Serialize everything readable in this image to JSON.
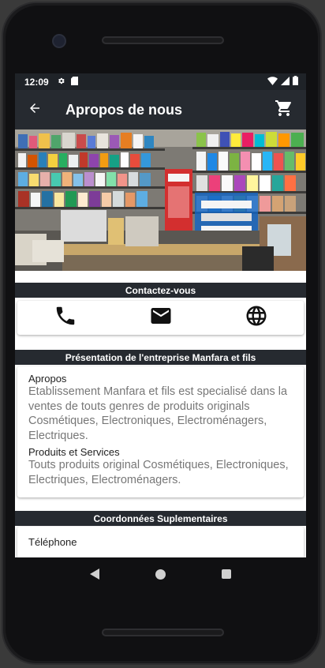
{
  "status_bar": {
    "time": "12:09",
    "left_icons": [
      "gear-icon",
      "sd-card-icon"
    ],
    "right_icons": [
      "wifi-icon",
      "signal-icon",
      "battery-icon"
    ]
  },
  "app_bar": {
    "title": "Apropos de nous",
    "back_icon": "arrow-back-icon",
    "cart_icon": "shopping-cart-icon"
  },
  "sections": {
    "contact_header": "Contactez-vous",
    "presentation_header": "Présentation de l'entreprise Manfara et fils",
    "extra_header": "Coordonnées Suplementaires"
  },
  "contact_actions": [
    "phone-icon",
    "email-icon",
    "globe-icon"
  ],
  "presentation": {
    "about_label": "Apropos",
    "about_text": "Etablissement Manfara et fils est specialisé dans la ventes de touts genres de produits originals Cosmétiques, Electroniques, Electroménagers, Electriques.",
    "products_label": "Produits et Services",
    "products_text": "Touts produits original Cosmétiques, Electroniques, Electriques, Electroménagers."
  },
  "extra": {
    "phone_label": "Téléphone"
  },
  "colors": {
    "app_bar": "#262a30",
    "status_bar": "#1f2328",
    "section_header": "#262a30",
    "body_text": "#777777"
  }
}
